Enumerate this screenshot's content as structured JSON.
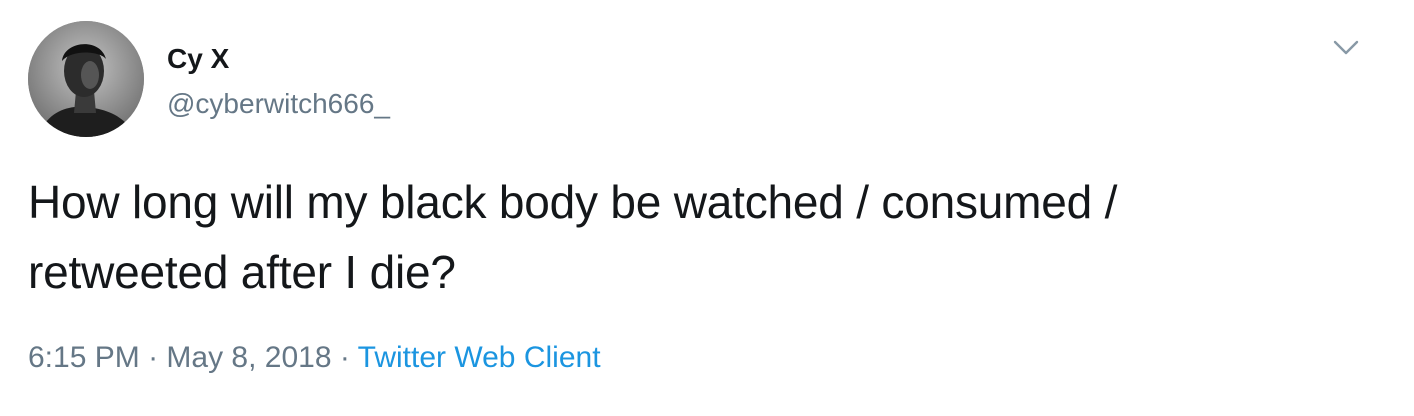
{
  "tweet": {
    "author": {
      "display_name": "Cy X",
      "handle": "@cyberwitch666_"
    },
    "text_lines": [
      "How long will my black body be watched / consumed /",
      "retweeted after I die?"
    ],
    "time": "6:15 PM",
    "separator": "·",
    "date": "May 8, 2018",
    "source": "Twitter Web Client",
    "menu_icon": "chevron-down-icon",
    "colors": {
      "text": "#14171a",
      "secondary": "#657786",
      "link": "#1b95e0"
    }
  }
}
